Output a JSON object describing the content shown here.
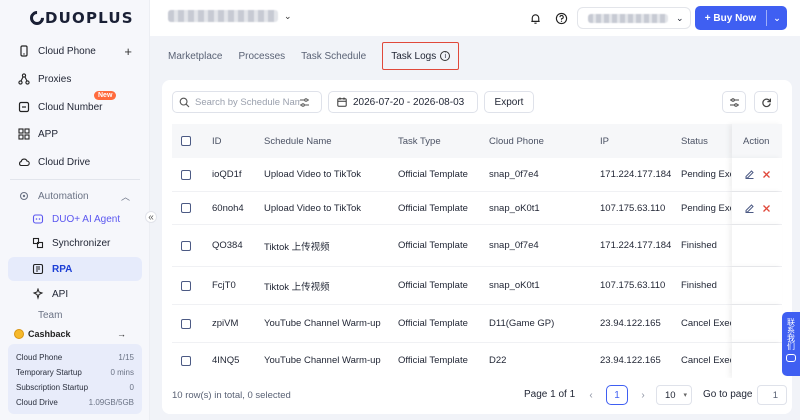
{
  "brand": {
    "name": "DUOPLUS"
  },
  "sidebar": {
    "items": [
      {
        "label": "Cloud Phone",
        "icon": "phone-icon"
      },
      {
        "label": "Proxies",
        "icon": "proxy-icon"
      },
      {
        "label": "Cloud Number",
        "icon": "number-icon",
        "badge": "New"
      },
      {
        "label": "APP",
        "icon": "apps-icon"
      },
      {
        "label": "Cloud Drive",
        "icon": "cloud-icon"
      }
    ],
    "automation": {
      "label": "Automation",
      "items": [
        {
          "label": "DUO+ AI Agent"
        },
        {
          "label": "Synchronizer"
        },
        {
          "label": "RPA"
        },
        {
          "label": "API"
        }
      ]
    },
    "team_label": "Team",
    "collapse_label": "«",
    "cashback_label": "Cashback",
    "usage": [
      {
        "label": "Cloud Phone",
        "value": "1/15"
      },
      {
        "label": "Temporary Startup",
        "value": "0 mins"
      },
      {
        "label": "Subscription Startup",
        "value": "0"
      },
      {
        "label": "Cloud Drive",
        "value": "1.09GB/5GB"
      }
    ]
  },
  "topbar": {
    "buy_label": "+ Buy Now"
  },
  "tabs": [
    "Marketplace",
    "Processes",
    "Task Schedule",
    "Task Logs"
  ],
  "active_tab": "Task Logs",
  "toolbar": {
    "search_placeholder": "Search by Schedule Name",
    "date_range": "2026-07-20 - 2026-08-03",
    "export_label": "Export"
  },
  "table": {
    "columns": [
      "ID",
      "Schedule Name",
      "Task Type",
      "Cloud Phone",
      "IP",
      "Status",
      "Action"
    ],
    "rows": [
      {
        "id": "ioQD1f",
        "name": "Upload Video to TikTok",
        "type": "Official Template",
        "phone": "snap_0f7e4",
        "ip": "171.224.177.184",
        "status": "Pending Exe",
        "editable": true
      },
      {
        "id": "60noh4",
        "name": "Upload Video to TikTok",
        "type": "Official Template",
        "phone": "snap_oK0t1",
        "ip": "107.175.63.110",
        "status": "Pending Exe",
        "editable": true
      },
      {
        "id": "QO384",
        "name": "Tiktok 上传视频",
        "type": "Official Template",
        "phone": "snap_0f7e4",
        "ip": "171.224.177.184",
        "status": "Finished",
        "editable": false
      },
      {
        "id": "FcjT0",
        "name": "Tiktok 上传视频",
        "type": "Official Template",
        "phone": "snap_oK0t1",
        "ip": "107.175.63.110",
        "status": "Finished",
        "editable": false
      },
      {
        "id": "zpiVM",
        "name": "YouTube Channel Warm-up",
        "type": "Official Template",
        "phone": "D11(Game GP)",
        "ip": "23.94.122.165",
        "status": "Cancel Exec",
        "editable": false
      },
      {
        "id": "4INQ5",
        "name": "YouTube Channel Warm-up",
        "type": "Official Template",
        "phone": "D22",
        "ip": "23.94.122.165",
        "status": "Cancel Exec",
        "editable": false
      }
    ]
  },
  "footer": {
    "total": "10 row(s) in total, 0 selected",
    "page_info": "Page 1 of 1",
    "current_page": "1",
    "page_size": "10",
    "goto_label": "Go to page",
    "goto_value": "1"
  },
  "contact": {
    "label": "联系我们"
  },
  "colors": {
    "accent": "#3f5ff2",
    "highlight_border": "#e0483a",
    "edit": "#4c5a84",
    "delete": "#e0483a"
  }
}
